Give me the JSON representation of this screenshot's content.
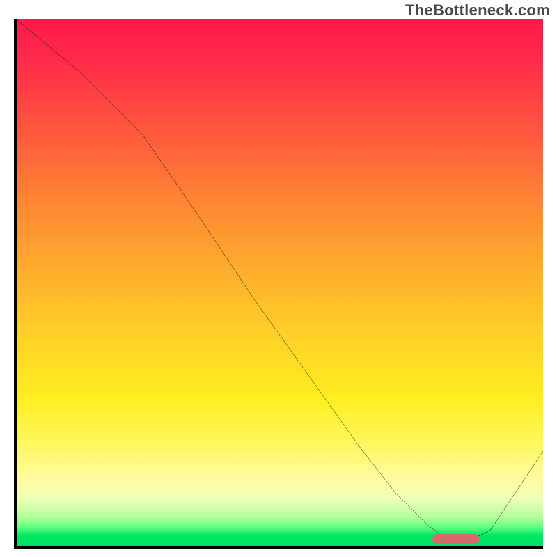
{
  "watermark": "TheBottleneck.com",
  "chart_data": {
    "type": "line",
    "title": "",
    "xlabel": "",
    "ylabel": "",
    "xlim": [
      0,
      100
    ],
    "ylim": [
      0,
      100
    ],
    "grid": false,
    "legend": false,
    "curve": {
      "x": [
        0,
        6,
        12,
        18,
        24,
        35,
        45,
        55,
        65,
        72,
        78,
        82,
        86,
        90,
        100
      ],
      "y": [
        100,
        95,
        90,
        84,
        78,
        62,
        47,
        33,
        19,
        10,
        4,
        1,
        1,
        3,
        18
      ]
    },
    "optimum_marker": {
      "x_start": 79,
      "x_end": 88,
      "y": 1
    },
    "background_gradient": {
      "direction": "vertical",
      "stops": [
        {
          "pos": 0.0,
          "color": "#ff1a4a"
        },
        {
          "pos": 0.22,
          "color": "#ff5a3e"
        },
        {
          "pos": 0.5,
          "color": "#ffb42c"
        },
        {
          "pos": 0.72,
          "color": "#ffee20"
        },
        {
          "pos": 0.87,
          "color": "#fffb9e"
        },
        {
          "pos": 0.95,
          "color": "#b4ff9e"
        },
        {
          "pos": 1.0,
          "color": "#00e05f"
        }
      ]
    }
  }
}
